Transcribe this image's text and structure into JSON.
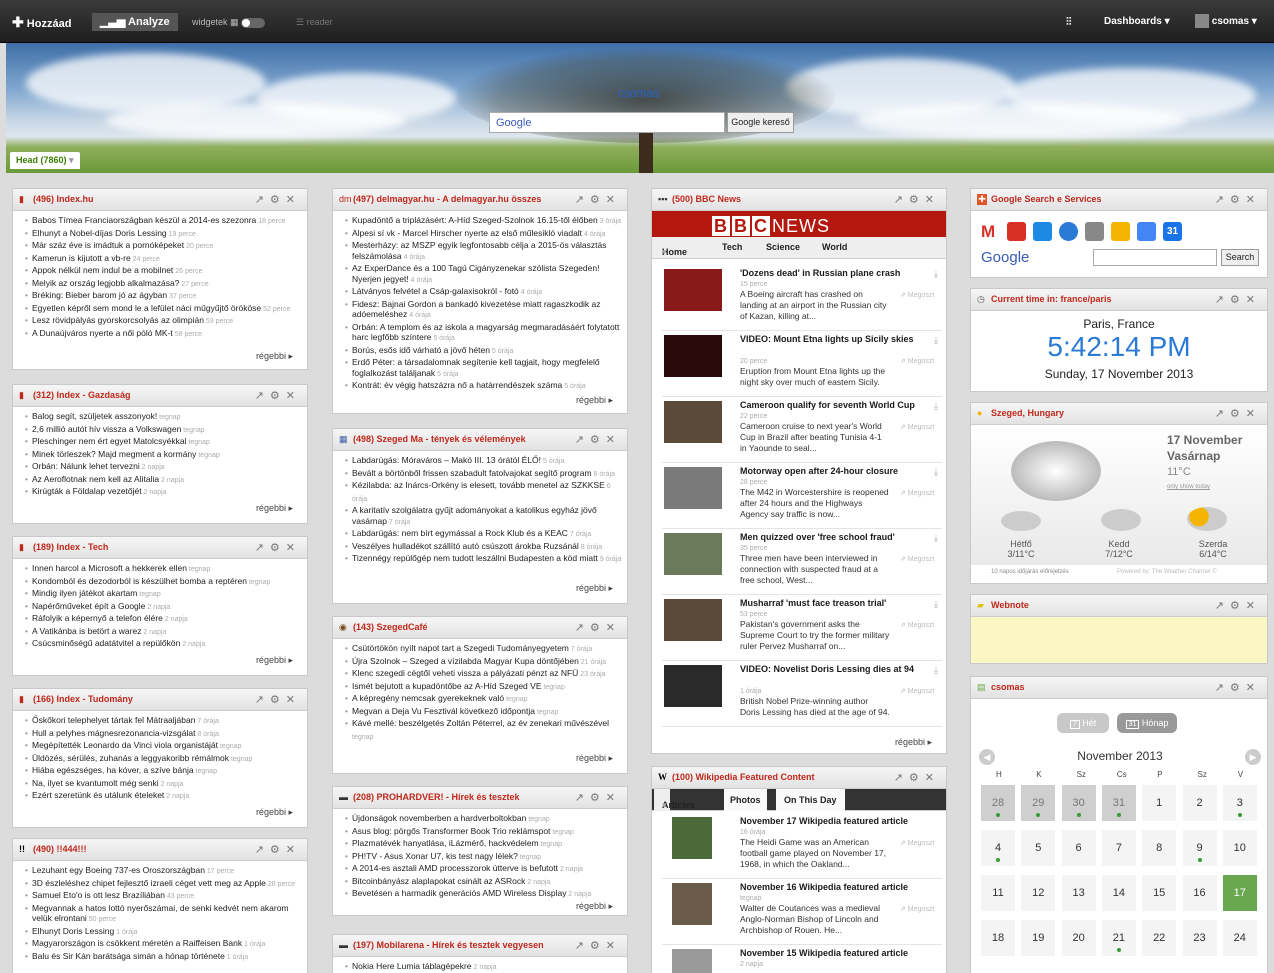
{
  "topbar": {
    "add": "Hozzáad",
    "analyze": "Analyze",
    "widgets": "widgetek",
    "reader": "reader",
    "dashboards": "Dashboards",
    "user": "csomas"
  },
  "header": {
    "title": "csomas",
    "search_logo": "Google",
    "search_button": "Google kereső",
    "tab": "Head (7860)",
    "tab_arrow": "▾",
    "plus": "+"
  },
  "col1": [
    {
      "title": "(496) Index.hu",
      "items": [
        [
          "Babos Tímea Franciaországban készül a 2014-es szezonra",
          "18 perce"
        ],
        [
          "Elhunyt a Nobel-díjas Doris Lessing",
          "19 perce"
        ],
        [
          "Már száz éve is imádtuk a pornóképeket",
          "20 perce"
        ],
        [
          "Kamerun is kijutott a vb-re",
          "24 perce"
        ],
        [
          "Appok nélkül nem indul be a mobilnet",
          "26 perce"
        ],
        [
          "Melyik az ország legjobb alkalmazása?",
          "27 perce"
        ],
        [
          "Bréking: Bieber barom jó az ágyban",
          "37 perce"
        ],
        [
          "Egyetlen képről sem mond le a lefület náci műgyűjtő örököse",
          "52 perce"
        ],
        [
          "Lesz rövidpályás gyorskorcsolyás az olimpián",
          "53 perce"
        ],
        [
          "A Dunaújváros nyerte a női póló MK-t",
          "58 perce"
        ]
      ],
      "more": "régebbi"
    },
    {
      "title": "(312) Index - Gazdaság",
      "items": [
        [
          "Balog segít, szüljetek asszonyok!",
          "tegnap"
        ],
        [
          "2,6 millió autót hív vissza a Volkswagen",
          "tegnap"
        ],
        [
          "Pleschinger nem ért egyet Matolcsyékkal",
          "tegnap"
        ],
        [
          "Minek törleszek? Majd megment a kormány",
          "tegnap"
        ],
        [
          "Orbán: Nálunk lehet tervezni",
          "2 napja"
        ],
        [
          "Az Aeroflotnak nem kell az Alitalia",
          "2 napja"
        ],
        [
          "Kirúgták a Földalap vezetőjét",
          "2 napja"
        ]
      ],
      "more": "régebbi"
    },
    {
      "title": "(189) Index - Tech",
      "items": [
        [
          "Innen harcol a Microsoft a hekkerek ellen",
          "tegnap"
        ],
        [
          "Kondomból és dezodorból is készülhet bomba a reptéren",
          "tegnap"
        ],
        [
          "Mindig ilyen játékot akartam",
          "tegnap"
        ],
        [
          "Napérőműveket épít a Google",
          "2 napja"
        ],
        [
          "Ráfolyik a képernyő a telefon élére",
          "2 napja"
        ],
        [
          "A Vatikánba is betört a warez",
          "2 napja"
        ],
        [
          "Csúcsminőségű adatátvitel a repülőkön",
          "2 napja"
        ]
      ],
      "more": "régebbi"
    },
    {
      "title": "(166) Index - Tudomány",
      "items": [
        [
          "Őskőkori telephelyet tártak fel Mátraaljában",
          "7 órája"
        ],
        [
          "Hull a pelyhes mágnesrezonancia-vizsgálat",
          "8 órája"
        ],
        [
          "Megépítették Leonardo da Vinci viola organistáját",
          "tegnap"
        ],
        [
          "Üldözés, sérülés, zuhanás a leggyakoribb rémálmok",
          "tegnap"
        ],
        [
          "Hiába egészséges, ha kóver, a szíve bánja",
          "tegnap"
        ],
        [
          "Na, ilyet se kvantumolt még senki",
          "2 napja"
        ],
        [
          "Ezért szeretünk és utálunk ételeket",
          "2 napja"
        ]
      ],
      "more": "régebbi"
    },
    {
      "title": "(490) !!444!!!",
      "items": [
        [
          "Lezuhant egy Boeing 737-es Oroszországban",
          "17 perce"
        ],
        [
          "3D észleléshez chipet fejlesztő izraeli céget vett meg az Apple",
          "28 perce"
        ],
        [
          "Samuel Eto'o is ott lesz Brazíliában",
          "43 perce"
        ],
        [
          "Megvannak a hatos lottó nyerőszámai, de senki kedvét nem akarom velük elrontani",
          "50 perce"
        ],
        [
          "Elhunyt Doris Lessing",
          "1 órája"
        ],
        [
          "Magyarországon is csökkent méretén a Raiffeisen Bank",
          "1 órája"
        ],
        [
          "Balu és Sir Kán barátsága simán a hónap története",
          "1 órája"
        ]
      ]
    }
  ],
  "col2": [
    {
      "title": "(497) delmagyar.hu - A delmagyar.hu összes",
      "items": [
        [
          "Kupadöntő a triplázásért: A-Híd Szeged-Szolnok 16.15-től élőben",
          "3 órája"
        ],
        [
          "Alpesi sí vk - Marcel Hirscher nyerte az első műlesikló viadalt",
          "4 órája"
        ],
        [
          "Mesterházy: az MSZP egyik legfontosabb célja a 2015-ös választás felszámolása",
          "4 órája"
        ],
        [
          "Az ExperDance és a 100 Tagú Cigányzenekar szólista Szegeden! Nyerjen jegyet!",
          "4 órája"
        ],
        [
          "Látványos felvétel a Csáp-galaxisokról - fotó",
          "4 órája"
        ],
        [
          "Fidesz: Bajnai Gordon a bankadó kivezetése miatt ragaszkodik az adóemeléshez",
          "4 órája"
        ],
        [
          "Orbán: A templom és az iskola a magyarság megmaradásáért folytatott harc legfőbb színtere",
          "5 órája"
        ],
        [
          "Borús, esős idő várható a jövő héten",
          "5 órája"
        ],
        [
          "Erdő Péter: a társadalomnak segítenie kell tagjait, hogy megfelelő foglalkozást találjanak",
          "5 órája"
        ],
        [
          "Kontrát: év végig hatszázra nő a határrendészek száma",
          "5 órája"
        ]
      ],
      "more": "régebbi"
    },
    {
      "title": "(498) Szeged Ma - tények és vélemények",
      "items": [
        [
          "Labdarúgás: Móraváros – Makó III. 13 órától ÉLŐ!",
          "5 órája"
        ],
        [
          "Bevált a börtönből frissen szabadult fatolvajokat segítő program",
          "6 órája"
        ],
        [
          "Kézilabda: az Inárcs-Orkény is elesett, tovább menetel az SZKKSE",
          "6 órája"
        ],
        [
          "A karitatív szolgálatra gyűjt adományokat a katolikus egyház jövő vasárnap",
          "7 órája"
        ],
        [
          "Labdarúgás: nem bírt egymással a Rock Klub és a KEAC",
          "7 órája"
        ],
        [
          "Veszélyes hulladékot szállító autó csúszott árokba Ruzsánál",
          "8 órája"
        ],
        [
          "Tizennégy repülőgép nem tudott leszállni Budapesten a köd miatt",
          "9 órája"
        ]
      ],
      "more": "régebbi"
    },
    {
      "title": "(143) SzegedCafé",
      "items": [
        [
          "Csütörtökön nyílt napot tart a Szegedi Tudományegyetem",
          "7 órája"
        ],
        [
          "Újra Szolnok – Szeged a vízilabda Magyar Kupa döntőjében",
          "21 órája"
        ],
        [
          "Klenc szegedi cégtől veheti vissza a pályázati pénzt az NFÜ",
          "23 órája"
        ],
        [
          "Ismét bejutott a kupadöntőbe az A-Híd Szeged VE",
          "tegnap"
        ],
        [
          "A képregény nemcsak gyerekeknek való",
          "tegnap"
        ],
        [
          "Megvan a Deja Vu Fesztivál következő időpontja",
          "tegnap"
        ],
        [
          "Kávé mellé: beszélgetés Zoltán Péterrel, az év zenekari művészével",
          "tegnap"
        ]
      ],
      "more": "régebbi"
    },
    {
      "title": "(208) PROHARDVER! - Hírek és tesztek",
      "items": [
        [
          "Újdonságok novemberben a hardverboltokban",
          "tegnap"
        ],
        [
          "Asus blog: pörgős Transformer Book Trio reklámspot",
          "tegnap"
        ],
        [
          "Plazmatévék hanyatlása, iLázmérő, hackvédelem",
          "tegnap"
        ],
        [
          "PH!TV - Asus Xonar U7, kis test nagy lélek?",
          "tegnap"
        ],
        [
          "A 2014-es asztali AMD processzorok útterve is befutott",
          "2 napja"
        ],
        [
          "Bitcoinbányász alaplapokat csinált az ASRock",
          "2 napja"
        ],
        [
          "Bevetésen a harmadik generációs AMD Wireless Display",
          "2 napja"
        ]
      ],
      "more": "régebbi"
    },
    {
      "title": "(197) Mobilarena - Hírek és tesztek vegyesen",
      "items": [
        [
          "Nokia Here Lumia táblagépekre",
          "2 napja"
        ]
      ]
    }
  ],
  "bbc": {
    "title": "(500) BBC News",
    "logo_news": "NEWS",
    "tabs": [
      "Home",
      "Tech",
      "Science",
      "World"
    ],
    "more": "régebbi",
    "share": "Megoszt",
    "items": [
      {
        "title": "'Dozens dead' in Russian plane crash",
        "time": "15 perce",
        "text": "A Boeing aircraft has crashed on landing at an airport in the Russian city of Kazan, killing at..."
      },
      {
        "title": "VIDEO: Mount Etna lights up Sicily skies",
        "time": "20 perce",
        "text": "Eruption from Mount Etna lights up the night sky over much of eastern Sicily."
      },
      {
        "title": "Cameroon qualify for seventh World Cup",
        "time": "22 perce",
        "text": "Cameroon cruise to next year's World Cup in Brazil after beating Tunisia 4-1 in Yaounde to seal..."
      },
      {
        "title": "Motorway open after 24-hour closure",
        "time": "28 perce",
        "text": "The M42 in Worcestershire is reopened after 24 hours and the Highways Agency say traffic is now..."
      },
      {
        "title": "Men quizzed over 'free school fraud'",
        "time": "35 perce",
        "text": "Three men have been interviewed in connection with suspected fraud at a free school, West..."
      },
      {
        "title": "Musharraf 'must face treason trial'",
        "time": "53 perce",
        "text": "Pakistan's government asks the Supreme Court to try the former military ruler Pervez Musharraf on..."
      },
      {
        "title": "VIDEO: Novelist Doris Lessing dies at 94",
        "time": "1 órája",
        "text": "British Nobel Prize-winning author Doris Lessing has died at the age of 94."
      }
    ]
  },
  "wiki": {
    "title": "(100) Wikipedia Featured Content",
    "tabs": [
      "Articles",
      "Photos",
      "On This Day"
    ],
    "share": "Megoszt",
    "items": [
      {
        "title": "November 17 Wikipedia featured article",
        "time": "16 órája",
        "text": "The Heidi Game was an American football game played on November 17, 1968, in which the Oakland..."
      },
      {
        "title": "November 16 Wikipedia featured article",
        "time": "tegnap",
        "text": "Walter de Coutances was a medieval Anglo-Norman Bishop of Lincoln and Archbishop of Rouen. He..."
      },
      {
        "title": "November 15 Wikipedia featured article",
        "time": "2 napja",
        "text": ""
      }
    ]
  },
  "gservices": {
    "title": "Google Search e Services",
    "logo": "Google",
    "search": "Search"
  },
  "clock": {
    "title": "Current time in: france/paris",
    "place": "Paris, France",
    "time": "5:42:14 PM",
    "date": "Sunday, 17 November 2013"
  },
  "weather": {
    "title": "Szeged, Hungary",
    "date": "17 November",
    "day": "Vasárnap",
    "temp": "11°C",
    "link": "only show today",
    "forecast": [
      {
        "d": "Hétfő",
        "t": "3/11°C"
      },
      {
        "d": "Kedd",
        "t": "7/12°C"
      },
      {
        "d": "Szerda",
        "t": "6/14°C"
      }
    ],
    "foot": "10 napos időjárás előrejelzés",
    "powered": "Powered by: The Weather Channel ©"
  },
  "webnote": {
    "title": "Webnote"
  },
  "calendar": {
    "title": "csomas",
    "week": "Hét",
    "month": "Hónap",
    "month_title": "November 2013",
    "week_icon": "7",
    "month_icon": "31",
    "days": [
      "H",
      "K",
      "Sz",
      "Cs",
      "P",
      "Sz",
      "V"
    ],
    "cells": [
      "28",
      "29",
      "30",
      "31",
      "1",
      "2",
      "3",
      "4",
      "5",
      "6",
      "7",
      "8",
      "9",
      "10",
      "11",
      "12",
      "13",
      "14",
      "15",
      "16",
      "17",
      "18",
      "19",
      "20",
      "21",
      "22",
      "23",
      "24"
    ]
  },
  "colors": {
    "red": "#c0281c",
    "green": "#6aa84f",
    "bbc": "#b3170e",
    "clock": "#2a7ad6"
  }
}
